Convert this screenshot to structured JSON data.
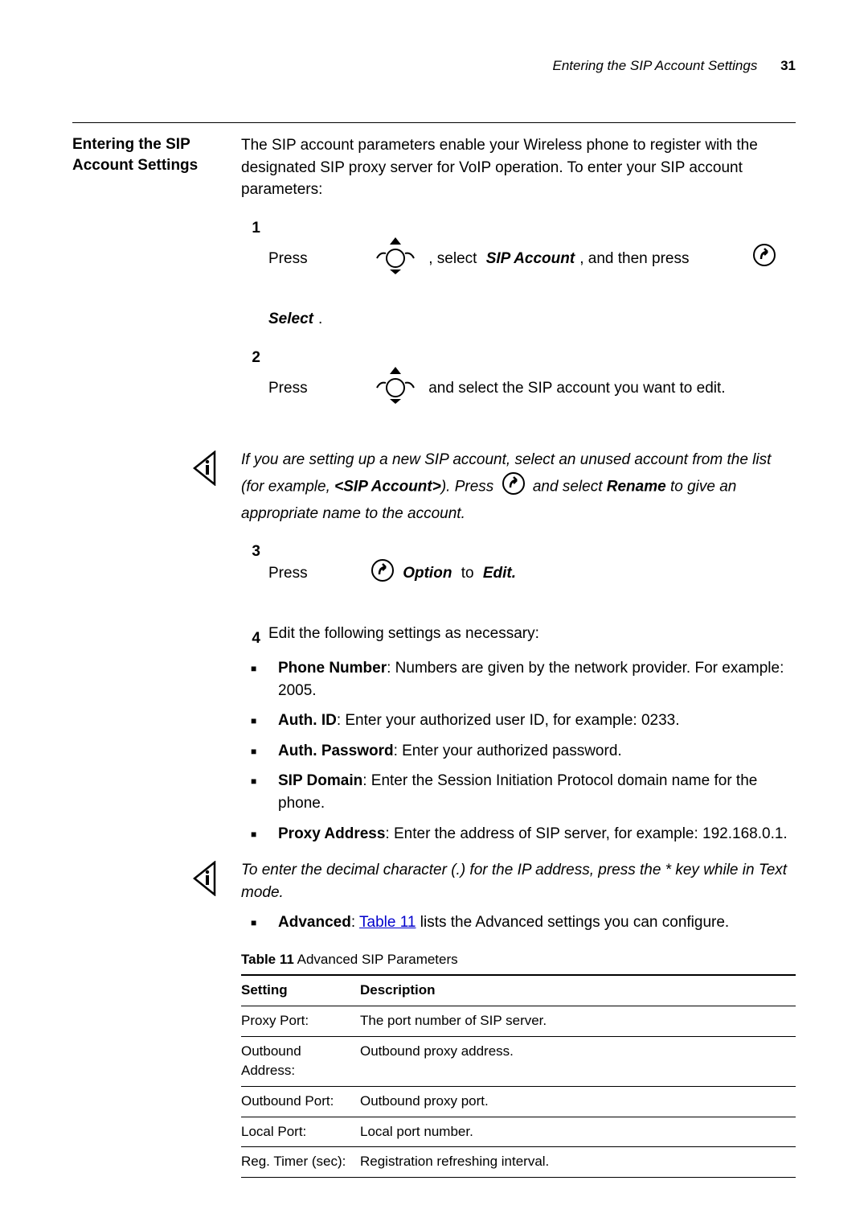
{
  "header": {
    "title": "Entering the SIP Account Settings",
    "page_number": "31"
  },
  "sidehead": "Entering the SIP Account Settings",
  "intro": "The SIP account parameters enable your Wireless phone to register with the designated SIP proxy server for VoIP operation. To enter your SIP account parameters:",
  "step1": {
    "num": "1",
    "t1": "Press ",
    "t2": ", select ",
    "b1": "SIP Account",
    "t3": ", and then press ",
    "b2": "Select",
    "t4": "."
  },
  "step2": {
    "num": "2",
    "t1": "Press ",
    "t2": "and select the SIP account you want to edit."
  },
  "note1": {
    "t1": "If you are setting up a new SIP account, select an unused account from the list (for example, ",
    "b1": "<SIP Account>",
    "t2": "). Press ",
    "t3": " and select ",
    "b2": "Rename",
    "t4": " to give an appropriate name to the account."
  },
  "step3": {
    "num": "3",
    "t1": "Press ",
    "b1": "Option",
    "t2": " to ",
    "b2": "Edit."
  },
  "step4": {
    "num": "4",
    "t1": "Edit the following settings as necessary:"
  },
  "bullets": [
    {
      "label": "Phone Number",
      "text": ": Numbers are given by the network provider. For example: 2005."
    },
    {
      "label": "Auth. ID",
      "text": ": Enter your authorized user ID, for example: 0233."
    },
    {
      "label": "Auth. Password",
      "text": ": Enter your authorized password."
    },
    {
      "label": "SIP Domain",
      "text": ": Enter the Session Initiation Protocol domain name for the phone."
    },
    {
      "label": "Proxy Address",
      "text": ": Enter the address of SIP server, for example: 192.168.0.1."
    }
  ],
  "note2": "To enter the decimal character (.) for the IP address, press the * key while in Text mode.",
  "last_bullet": {
    "label": "Advanced",
    "link": "Table 11",
    "after": " lists the Advanced settings you can configure."
  },
  "table": {
    "caption_bold": "Table 11",
    "caption_rest": "   Advanced SIP Parameters",
    "h1": "Setting",
    "h2": "Description",
    "rows": [
      {
        "s": "Proxy Port:",
        "d": "The port number of SIP server."
      },
      {
        "s": "Outbound Address:",
        "d": "Outbound proxy address."
      },
      {
        "s": "Outbound Port:",
        "d": "Outbound proxy port."
      },
      {
        "s": "Local Port:",
        "d": "Local port number."
      },
      {
        "s": "Reg. Timer (sec):",
        "d": "Registration refreshing interval."
      }
    ]
  }
}
